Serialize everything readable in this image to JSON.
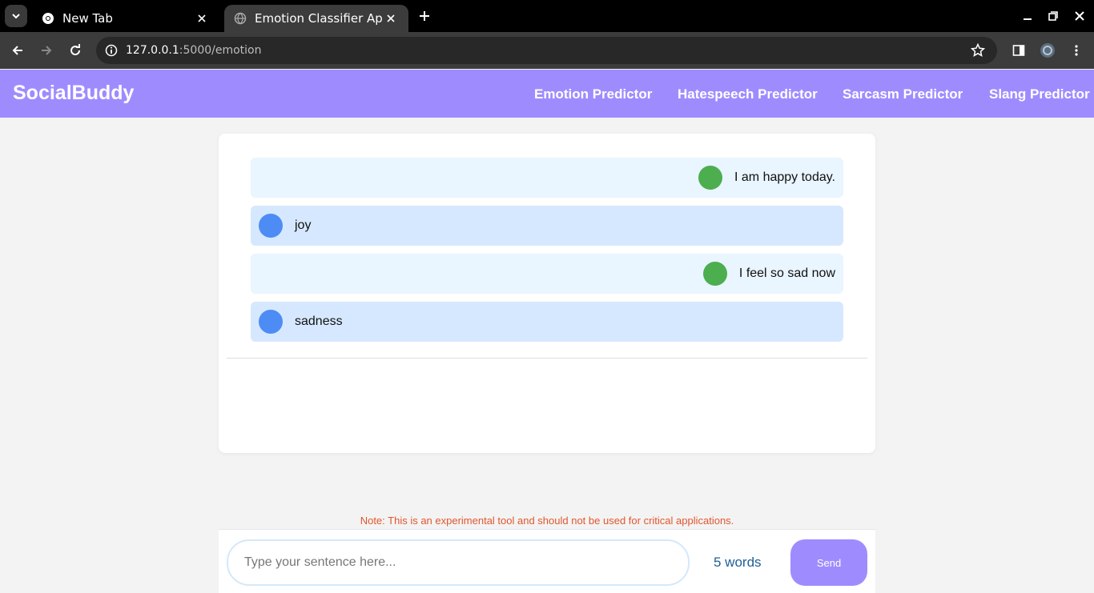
{
  "browser": {
    "tabs": [
      {
        "title": "New Tab",
        "active": false
      },
      {
        "title": "Emotion Classifier App",
        "active": true
      }
    ],
    "url_host": "127.0.0.1",
    "url_path": ":5000/emotion"
  },
  "navbar": {
    "brand": "SocialBuddy",
    "links": [
      "Emotion Predictor",
      "Hatespeech Predictor",
      "Sarcasm Predictor",
      "Slang Predictor"
    ]
  },
  "chat": {
    "messages": [
      {
        "role": "user",
        "text": "I am happy today."
      },
      {
        "role": "bot",
        "text": "joy"
      },
      {
        "role": "user",
        "text": "I feel so sad now"
      },
      {
        "role": "bot",
        "text": "sadness"
      }
    ]
  },
  "note": "Note: This is an experimental tool and should not be used for critical applications.",
  "input": {
    "placeholder": "Type your sentence here...",
    "value": "",
    "word_count": "5 words",
    "send_label": "Send"
  },
  "colors": {
    "brand": "#9e8cff",
    "user_avatar": "#4cae4f",
    "bot_avatar": "#4d8cf5",
    "note": "#e2562e"
  }
}
